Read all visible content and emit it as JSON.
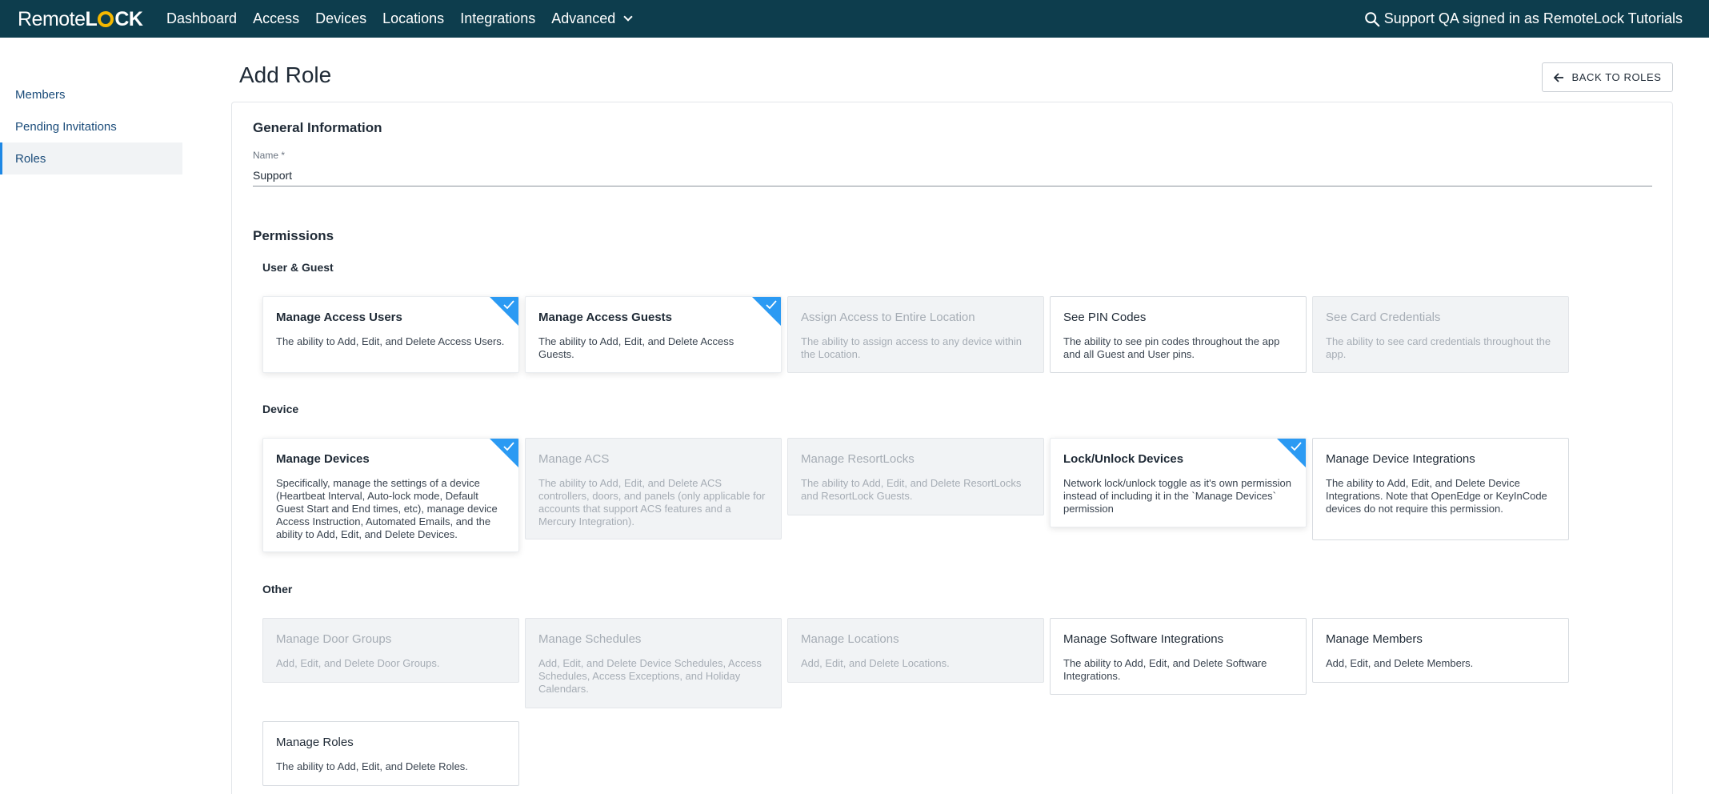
{
  "brand": {
    "part1": "Remote",
    "part2_before": "L",
    "part2_after": "CK"
  },
  "nav": {
    "items": [
      "Dashboard",
      "Access",
      "Devices",
      "Locations",
      "Integrations",
      "Advanced"
    ],
    "user_label": "Support QA signed in as RemoteLock Tutorials"
  },
  "sidebar": {
    "items": [
      "Members",
      "Pending Invitations",
      "Roles"
    ],
    "active": "Roles"
  },
  "page": {
    "title": "Add Role",
    "back_button": "BACK TO ROLES"
  },
  "general": {
    "title": "General Information",
    "name_label": "Name *",
    "name_value": "Support"
  },
  "permissions": {
    "title": "Permissions",
    "groups": [
      {
        "title": "User & Guest",
        "items": [
          {
            "title": "Manage Access Users",
            "desc": "The ability to Add, Edit, and Delete Access Users.",
            "state": "checked"
          },
          {
            "title": "Manage Access Guests",
            "desc": "The ability to Add, Edit, and Delete Access Guests.",
            "state": "checked"
          },
          {
            "title": "Assign Access to Entire Location",
            "desc": "The ability to assign access to any device within the Location.",
            "state": "disabled"
          },
          {
            "title": "See PIN Codes",
            "desc": "The ability to see pin codes throughout the app and all Guest and User pins.",
            "state": "enabled"
          },
          {
            "title": "See Card Credentials",
            "desc": "The ability to see card credentials throughout the app.",
            "state": "disabled"
          }
        ]
      },
      {
        "title": "Device",
        "items": [
          {
            "title": "Manage Devices",
            "desc": "Specifically, manage the settings of a device (Heartbeat Interval, Auto-lock mode, Default Guest Start and End times, etc), manage device Access Instruction, Automated Emails, and the ability to Add, Edit, and Delete Devices.",
            "state": "checked"
          },
          {
            "title": "Manage ACS",
            "desc": "The ability to Add, Edit, and Delete ACS controllers, doors, and panels (only applicable for accounts that support ACS features and a Mercury Integration).",
            "state": "disabled"
          },
          {
            "title": "Manage ResortLocks",
            "desc": "The ability to Add, Edit, and Delete ResortLocks and ResortLock Guests.",
            "state": "disabled"
          },
          {
            "title": "Lock/Unlock Devices",
            "desc": "Network lock/unlock toggle as it's own permission instead of including it in the `Manage Devices` permission",
            "state": "checked"
          },
          {
            "title": "Manage Device Integrations",
            "desc": "The ability to Add, Edit, and Delete Device Integrations. Note that OpenEdge or KeyInCode devices do not require this permission.",
            "state": "enabled"
          }
        ]
      },
      {
        "title": "Other",
        "items": [
          {
            "title": "Manage Door Groups",
            "desc": "Add, Edit, and Delete Door Groups.",
            "state": "disabled"
          },
          {
            "title": "Manage Schedules",
            "desc": "Add, Edit, and Delete Device Schedules, Access Schedules, Access Exceptions, and Holiday Calendars.",
            "state": "disabled"
          },
          {
            "title": "Manage Locations",
            "desc": "Add, Edit, and Delete Locations.",
            "state": "disabled"
          },
          {
            "title": "Manage Software Integrations",
            "desc": "The ability to Add, Edit, and Delete Software Integrations.",
            "state": "enabled"
          },
          {
            "title": "Manage Members",
            "desc": "Add, Edit, and Delete Members.",
            "state": "enabled"
          },
          {
            "title": "Manage Roles",
            "desc": "The ability to Add, Edit, and Delete Roles.",
            "state": "enabled"
          }
        ]
      }
    ]
  },
  "colors": {
    "nav_bg": "#0d3d4d",
    "check_blue": "#2b9af3",
    "brand_yellow": "#f5b800",
    "active_accent": "#1e88e5"
  }
}
